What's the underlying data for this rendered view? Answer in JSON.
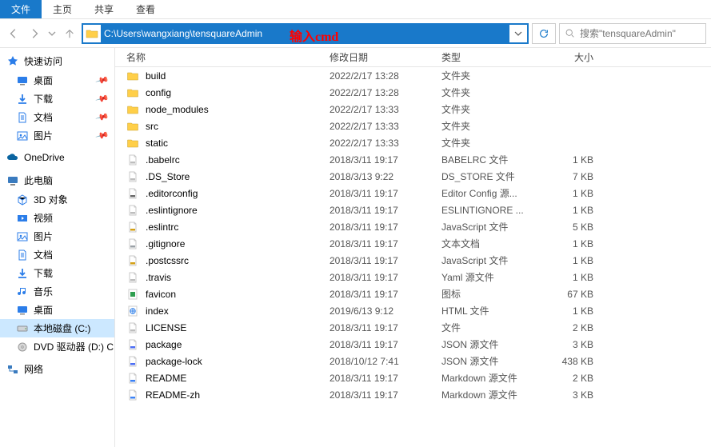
{
  "tabs": {
    "file": "文件",
    "home": "主页",
    "share": "共享",
    "view": "查看"
  },
  "address": {
    "path": "C:\\Users\\wangxiang\\tensquareAdmin",
    "annotation": "输入cmd"
  },
  "search": {
    "placeholder": "搜索\"tensquareAdmin\""
  },
  "sidebar": {
    "quick_access": "快速访问",
    "quick_items": [
      {
        "label": "桌面",
        "pinned": true,
        "icon": "desktop"
      },
      {
        "label": "下载",
        "pinned": true,
        "icon": "downloads"
      },
      {
        "label": "文档",
        "pinned": true,
        "icon": "documents"
      },
      {
        "label": "图片",
        "pinned": true,
        "icon": "pictures"
      }
    ],
    "onedrive": "OneDrive",
    "this_pc": "此电脑",
    "pc_items": [
      {
        "label": "3D 对象",
        "icon": "3d"
      },
      {
        "label": "视频",
        "icon": "videos"
      },
      {
        "label": "图片",
        "icon": "pictures"
      },
      {
        "label": "文档",
        "icon": "documents"
      },
      {
        "label": "下载",
        "icon": "downloads"
      },
      {
        "label": "音乐",
        "icon": "music"
      },
      {
        "label": "桌面",
        "icon": "desktop"
      },
      {
        "label": "本地磁盘 (C:)",
        "icon": "drive",
        "selected": true
      },
      {
        "label": "DVD 驱动器 (D:) C",
        "icon": "dvd"
      }
    ],
    "network": "网络"
  },
  "columns": {
    "name": "名称",
    "date": "修改日期",
    "type": "类型",
    "size": "大小"
  },
  "files": [
    {
      "name": "build",
      "date": "2022/2/17 13:28",
      "type": "文件夹",
      "size": "",
      "icon": "folder"
    },
    {
      "name": "config",
      "date": "2022/2/17 13:28",
      "type": "文件夹",
      "size": "",
      "icon": "folder"
    },
    {
      "name": "node_modules",
      "date": "2022/2/17 13:33",
      "type": "文件夹",
      "size": "",
      "icon": "folder"
    },
    {
      "name": "src",
      "date": "2022/2/17 13:33",
      "type": "文件夹",
      "size": "",
      "icon": "folder"
    },
    {
      "name": "static",
      "date": "2022/2/17 13:33",
      "type": "文件夹",
      "size": "",
      "icon": "folder"
    },
    {
      "name": ".babelrc",
      "date": "2018/3/11 19:17",
      "type": "BABELRC 文件",
      "size": "1 KB",
      "icon": "file"
    },
    {
      "name": ".DS_Store",
      "date": "2018/3/13 9:22",
      "type": "DS_STORE 文件",
      "size": "7 KB",
      "icon": "file"
    },
    {
      "name": ".editorconfig",
      "date": "2018/3/11 19:17",
      "type": "Editor Config 源...",
      "size": "1 KB",
      "icon": "gear"
    },
    {
      "name": ".eslintignore",
      "date": "2018/3/11 19:17",
      "type": "ESLINTIGNORE ...",
      "size": "1 KB",
      "icon": "file"
    },
    {
      "name": ".eslintrc",
      "date": "2018/3/11 19:17",
      "type": "JavaScript 文件",
      "size": "5 KB",
      "icon": "js"
    },
    {
      "name": ".gitignore",
      "date": "2018/3/11 19:17",
      "type": "文本文档",
      "size": "1 KB",
      "icon": "txt"
    },
    {
      "name": ".postcssrc",
      "date": "2018/3/11 19:17",
      "type": "JavaScript 文件",
      "size": "1 KB",
      "icon": "js"
    },
    {
      "name": ".travis",
      "date": "2018/3/11 19:17",
      "type": "Yaml 源文件",
      "size": "1 KB",
      "icon": "file"
    },
    {
      "name": "favicon",
      "date": "2018/3/11 19:17",
      "type": "图标",
      "size": "67 KB",
      "icon": "ico"
    },
    {
      "name": "index",
      "date": "2019/6/13 9:12",
      "type": "HTML 文件",
      "size": "1 KB",
      "icon": "html"
    },
    {
      "name": "LICENSE",
      "date": "2018/3/11 19:17",
      "type": "文件",
      "size": "2 KB",
      "icon": "file"
    },
    {
      "name": "package",
      "date": "2018/3/11 19:17",
      "type": "JSON 源文件",
      "size": "3 KB",
      "icon": "json"
    },
    {
      "name": "package-lock",
      "date": "2018/10/12 7:41",
      "type": "JSON 源文件",
      "size": "438 KB",
      "icon": "json"
    },
    {
      "name": "README",
      "date": "2018/3/11 19:17",
      "type": "Markdown 源文件",
      "size": "2 KB",
      "icon": "md"
    },
    {
      "name": "README-zh",
      "date": "2018/3/11 19:17",
      "type": "Markdown 源文件",
      "size": "3 KB",
      "icon": "md"
    }
  ],
  "icon_colors": {
    "folder": "#ffcf48",
    "file": "#bdbdbd",
    "gear": "#6b6b6b",
    "js": "#d4a016",
    "txt": "#9aa0a6",
    "ico": "#2e9e4f",
    "html": "#2b7de9",
    "json": "#4c6ef5",
    "md": "#3b82f6"
  }
}
